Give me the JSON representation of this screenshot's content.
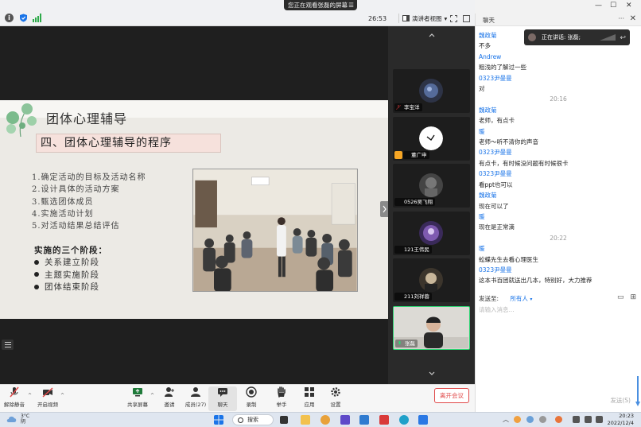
{
  "topbar": {
    "share_notice": "您正在观看张磊的屏幕",
    "menu_glyph": "☰",
    "elapsed": "26:53",
    "view_label": "演讲者视图",
    "view_caret": "▾"
  },
  "slide": {
    "title": "团体心理辅导",
    "subtitle": "四、团体心理辅导的程序",
    "steps": [
      "1.确定活动的目标及活动名称",
      "2.设计具体的活动方案",
      "3.甄选团体成员",
      "4.实施活动计划",
      "5.对活动结果总结评估"
    ],
    "stages_title": "实施的三个阶段：",
    "stages": [
      "关系建立阶段",
      "主题实施阶段",
      "团体结束阶段"
    ]
  },
  "gallery": {
    "participants": [
      {
        "name": "李宝洋",
        "muted": true
      },
      {
        "name": "董广申",
        "muted": true
      },
      {
        "name": "0526吴飞翔",
        "muted": true
      },
      {
        "name": "121王伟民",
        "muted": true
      },
      {
        "name": "211刘祥蓉",
        "muted": true
      },
      {
        "name": "张磊",
        "muted": false
      }
    ]
  },
  "chat": {
    "title": "聊天",
    "more": "···",
    "close": "✕",
    "speaking_label": "正在讲话: 张磊;",
    "speaking_back": "↩",
    "messages": [
      {
        "kind": "s",
        "text": "魏政菊"
      },
      {
        "kind": "c",
        "text": "不多"
      },
      {
        "kind": "s",
        "text": "Andrew"
      },
      {
        "kind": "c",
        "text": "粗浅的了解过一些"
      },
      {
        "kind": "s",
        "text": "0323尹曼曼"
      },
      {
        "kind": "c",
        "text": "对"
      },
      {
        "kind": "ts",
        "text": "20:16"
      },
      {
        "kind": "s",
        "text": "魏政菊"
      },
      {
        "kind": "c",
        "text": "老师，有点卡"
      },
      {
        "kind": "s",
        "text": "暖"
      },
      {
        "kind": "c",
        "text": "老师～听不清你的声音"
      },
      {
        "kind": "s",
        "text": "0323尹曼曼"
      },
      {
        "kind": "c",
        "text": "有点卡，有时候没问题有时候很卡"
      },
      {
        "kind": "s",
        "text": "0323尹曼曼"
      },
      {
        "kind": "c",
        "text": "看ppt也可以"
      },
      {
        "kind": "s",
        "text": "魏政菊"
      },
      {
        "kind": "c",
        "text": "现在可以了"
      },
      {
        "kind": "s",
        "text": "暖"
      },
      {
        "kind": "c",
        "text": "现在是正常滴"
      },
      {
        "kind": "ts",
        "text": "20:22"
      },
      {
        "kind": "s",
        "text": "暖"
      },
      {
        "kind": "c",
        "text": "蚣蝶先生去看心理医生"
      },
      {
        "kind": "s",
        "text": "0323尹曼曼"
      },
      {
        "kind": "c",
        "text": "这本书百团就送出几本，特别好，大力推荐"
      }
    ],
    "send_to_label": "发送至:",
    "send_to_target": "所有人",
    "send_to_caret": "▾",
    "input_placeholder": "请输入消息...",
    "send_label": "发送(S)"
  },
  "toolbar": {
    "mute": "解除静音",
    "video": "开启视频",
    "share": "共享屏幕",
    "invite": "邀请",
    "members": "成员(27)",
    "chat": "聊天",
    "record": "录制",
    "raise": "举手",
    "apps": "应用",
    "settings": "设置",
    "leave": "离开会议",
    "caret": "^"
  },
  "taskbar": {
    "temp": "3°C",
    "weather": "阴",
    "search": "搜索",
    "time": "20:23",
    "date": "2022/12/4"
  },
  "colors": {
    "accent": "#1a74e8",
    "active_border": "#2ed573",
    "leave_red": "#e04848"
  }
}
